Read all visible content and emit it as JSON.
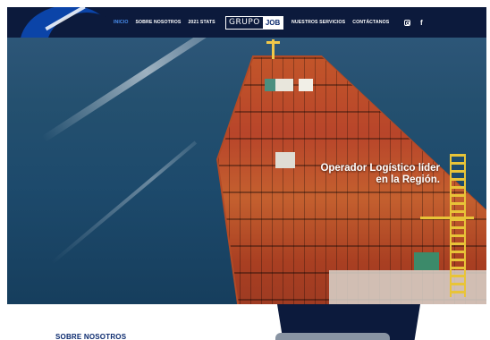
{
  "header": {
    "nav_left": [
      {
        "label": "Inicio",
        "active": true
      },
      {
        "label": "Sobre Nosotros",
        "active": false
      },
      {
        "label": "2021 Stats",
        "active": false
      }
    ],
    "brand": {
      "part1": "GRUPO",
      "part2": "JOB"
    },
    "nav_right": [
      {
        "label": "Nuestros Servicios",
        "active": false
      },
      {
        "label": "Contáctanos",
        "active": false
      }
    ],
    "social": {
      "instagram_icon": "instagram-icon",
      "facebook_glyph": "f"
    }
  },
  "hero": {
    "headline_line1": "Operador Logístico líder",
    "headline_line2": "en la Región."
  },
  "lower": {
    "section_title": "SOBRE NOSOTROS"
  },
  "colors": {
    "nav_bg": "#0c1a3c",
    "accent_blue": "#4a8ff0",
    "brand_navy": "#0b2a6e"
  }
}
